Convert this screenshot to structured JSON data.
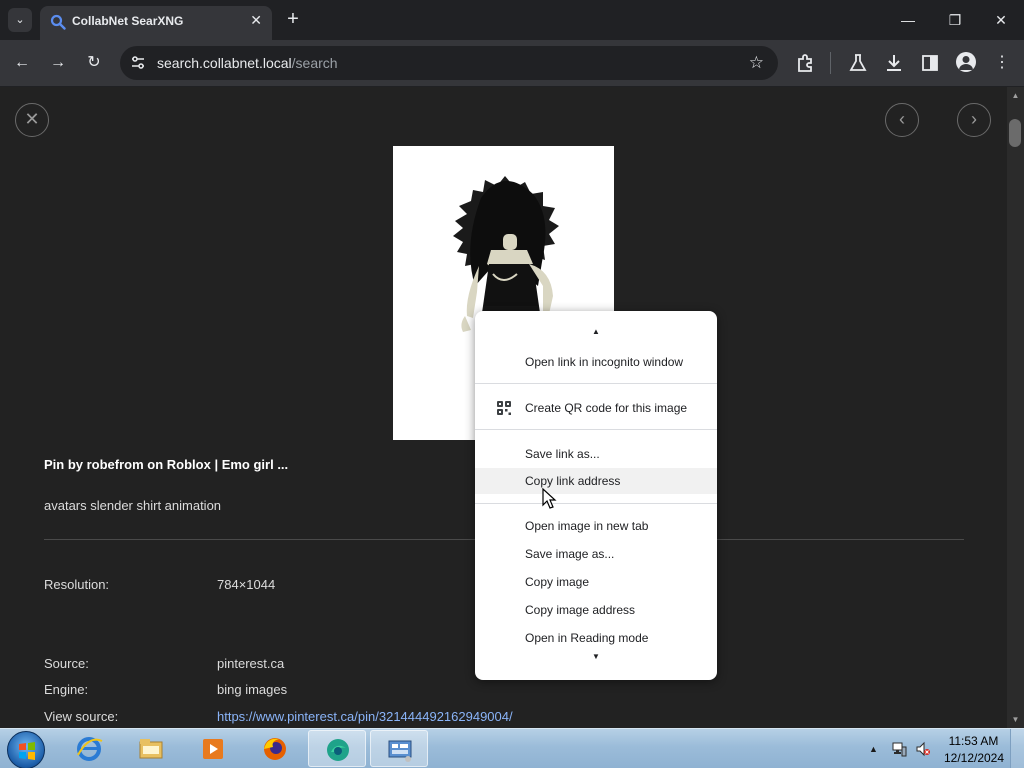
{
  "browser": {
    "tab_title": "CollabNet SearXNG",
    "url_host": "search.collabnet.local",
    "url_path": "/search",
    "new_tab": "+",
    "close_tab": "✕"
  },
  "result": {
    "title": "Pin by robefrom on Roblox | Emo girl ...",
    "description": "avatars slender shirt animation",
    "meta": [
      {
        "label": "Resolution:",
        "value": "784×1044"
      },
      {
        "label": "Source:",
        "value": "pinterest.ca"
      },
      {
        "label": "Engine:",
        "value": "bing images"
      },
      {
        "label": "View source:",
        "value": "https://www.pinterest.ca/pin/321444492162949004/"
      }
    ]
  },
  "context_menu": {
    "items": [
      "Open link in incognito window",
      "Create QR code for this image",
      "Save link as...",
      "Copy link address",
      "Open image in new tab",
      "Save image as...",
      "Copy image",
      "Copy image address",
      "Open in Reading mode"
    ],
    "hovered": "Copy link address"
  },
  "taskbar": {
    "time": "11:53 AM",
    "date": "12/12/2024"
  },
  "colors": {
    "page_bg": "#222222",
    "link": "#8ab4f8",
    "accent": "#4285f4"
  },
  "icons": [
    "tab-search-icon",
    "search-favicon",
    "back-icon",
    "forward-icon",
    "reload-icon",
    "site-info-icon",
    "star-icon",
    "extensions-icon",
    "labs-icon",
    "download-icon",
    "side-panel-icon",
    "profile-icon",
    "menu-icon",
    "close-icon",
    "prev-icon",
    "next-icon",
    "qr-code-icon",
    "windows-start-icon",
    "ie-icon",
    "explorer-icon",
    "media-player-icon",
    "firefox-icon",
    "edge-icon",
    "control-panel-icon",
    "network-icon",
    "volume-muted-icon"
  ]
}
